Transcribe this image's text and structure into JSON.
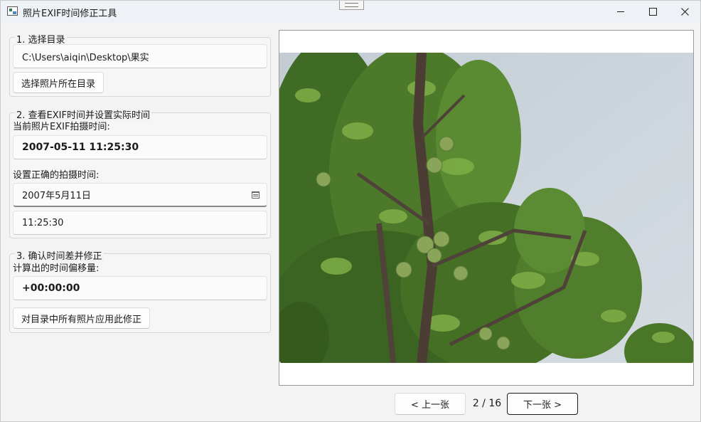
{
  "window": {
    "title": "照片EXIF时间修正工具"
  },
  "group1": {
    "title": "1. 选择目录",
    "directory": "C:\\Users\\aiqin\\Desktop\\果实",
    "choose_button": "选择照片所在目录"
  },
  "group2": {
    "title": "2. 查看EXIF时间并设置实际时间",
    "exif_label": "当前照片EXIF拍摄时间:",
    "exif_value": "2007-05-11 11:25:30",
    "correct_label": "设置正确的拍摄时间:",
    "date_value": "2007年5月11日",
    "time_value": "11:25:30"
  },
  "group3": {
    "title": "3. 确认时间差并修正",
    "offset_label": "计算出的时间偏移量:",
    "offset_value": "+00:00:00",
    "apply_button": "对目录中所有照片应用此修正"
  },
  "navigation": {
    "prev_button": "< 上一张",
    "page_indicator": "2 / 16",
    "next_button": "下一张 >"
  },
  "icons": {
    "app": "photo-app-icon",
    "date": "calendar-icon",
    "minimize": "minimize-icon",
    "maximize": "maximize-icon",
    "close": "close-icon"
  }
}
